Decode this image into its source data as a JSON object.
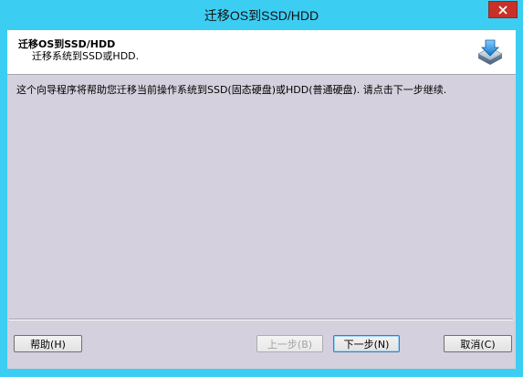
{
  "window": {
    "title": "迁移OS到SSD/HDD"
  },
  "header": {
    "title": "迁移OS到SSD/HDD",
    "subtitle": "迁移系统到SSD或HDD."
  },
  "main": {
    "description": "这个向导程序将帮助您迁移当前操作系统到SSD(固态硬盘)或HDD(普通硬盘). 请点击下一步继续."
  },
  "buttons": {
    "help": "帮助(H)",
    "back": "上一步(B)",
    "next": "下一步(N)",
    "cancel": "取消(C)"
  },
  "icons": {
    "close": "close-icon",
    "header": "disk-migrate-icon"
  },
  "colors": {
    "frame": "#3ccdf3",
    "close_button": "#c7312a",
    "client_background": "#d4d0dd",
    "header_background": "#ffffff"
  }
}
